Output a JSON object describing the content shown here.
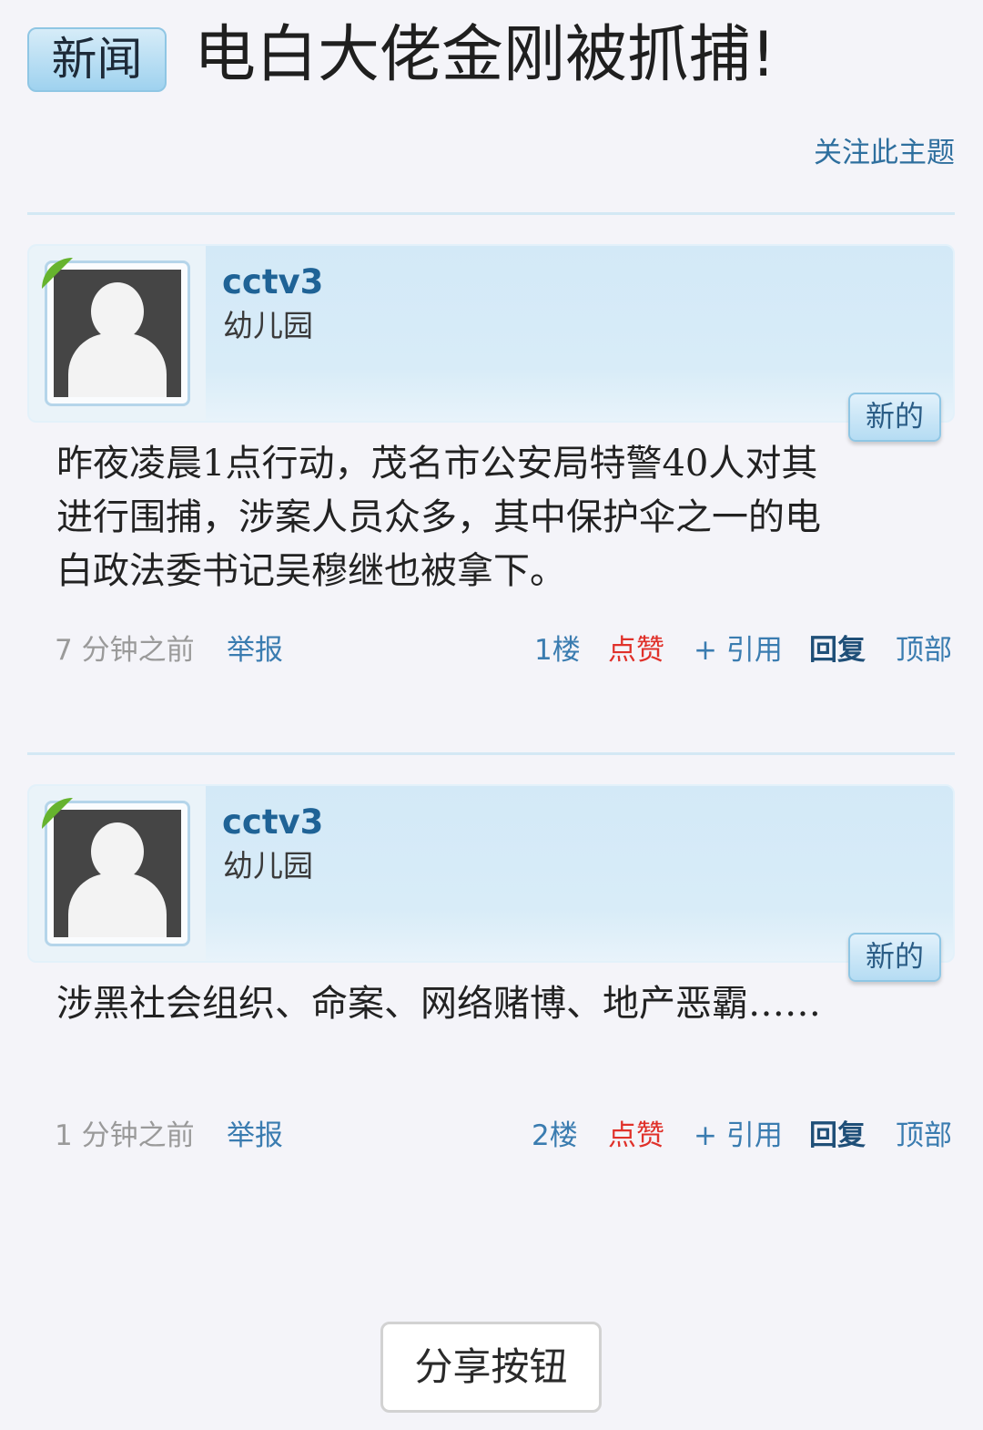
{
  "thread": {
    "tag": "新闻",
    "title": "电白大佬金刚被抓捕!",
    "follow_label": "关注此主题"
  },
  "posts": [
    {
      "username": "cctv3",
      "group": "幼儿园",
      "new_badge": "新的",
      "body": "昨夜凌晨1点行动，茂名市公安局特警40人对其进行围捕，涉案人员众多，其中保护伞之一的电白政法委书记吴穆继也被拿下。",
      "time": "7 分钟之前",
      "report": "举报",
      "floor": "1楼",
      "like": "点赞",
      "quote": "+ 引用",
      "reply": "回复",
      "top": "顶部"
    },
    {
      "username": "cctv3",
      "group": "幼儿园",
      "new_badge": "新的",
      "body": "涉黑社会组织、命案、网络赌博、地产恶霸……",
      "time": "1 分钟之前",
      "report": "举报",
      "floor": "2楼",
      "like": "点赞",
      "quote": "+ 引用",
      "reply": "回复",
      "top": "顶部"
    }
  ],
  "share_label": "分享按钮",
  "colors": {
    "link": "#3a7cb0",
    "like": "#e0312a",
    "online": "#66b32e"
  }
}
